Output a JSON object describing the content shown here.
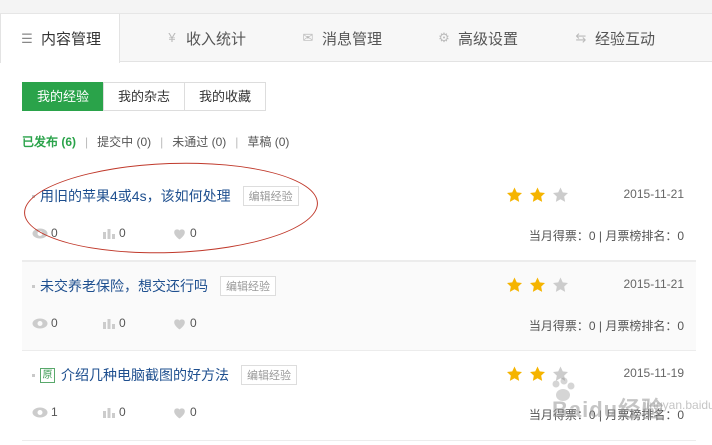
{
  "tabs": [
    {
      "label": "内容管理",
      "icon": "list-icon",
      "active": true
    },
    {
      "label": "收入统计",
      "icon": "yen-icon"
    },
    {
      "label": "消息管理",
      "icon": "envelope-icon"
    },
    {
      "label": "高级设置",
      "icon": "gear-icon"
    },
    {
      "label": "经验互动",
      "icon": "swap-icon"
    }
  ],
  "subtabs": [
    {
      "label": "我的经验",
      "active": true
    },
    {
      "label": "我的杂志"
    },
    {
      "label": "我的收藏"
    }
  ],
  "filters": [
    {
      "label": "已发布 (6)",
      "active": true
    },
    {
      "label": "提交中 (0)"
    },
    {
      "label": "未通过 (0)"
    },
    {
      "label": "草稿 (0)"
    }
  ],
  "edit_label": "编辑经验",
  "original_badge": "原",
  "items": [
    {
      "title": "用旧的苹果4或4s，该如何处理",
      "date": "2015-11-21",
      "stars": 2,
      "views": "0",
      "likes_bar": "0",
      "hearts": "0",
      "votes": "当月得票：0 | 月票榜排名：0",
      "original": false
    },
    {
      "title": "未交养老保险，想交还行吗",
      "date": "2015-11-21",
      "stars": 2,
      "views": "0",
      "likes_bar": "0",
      "hearts": "0",
      "votes": "当月得票：0 | 月票榜排名：0",
      "original": false
    },
    {
      "title": "介绍几种电脑截图的好方法",
      "date": "2015-11-19",
      "stars": 2,
      "views": "1",
      "likes_bar": "0",
      "hearts": "0",
      "votes": "当月得票：0 | 月票榜排名：0",
      "original": true
    }
  ],
  "watermark": {
    "text": "Baidu经验",
    "sub": "jingyan.baidu.com"
  },
  "colors": {
    "accent": "#2aa34a",
    "link": "#1e4f8f",
    "star": "#f5b400",
    "star_empty": "#cccccc",
    "annotation": "#c0392b"
  }
}
